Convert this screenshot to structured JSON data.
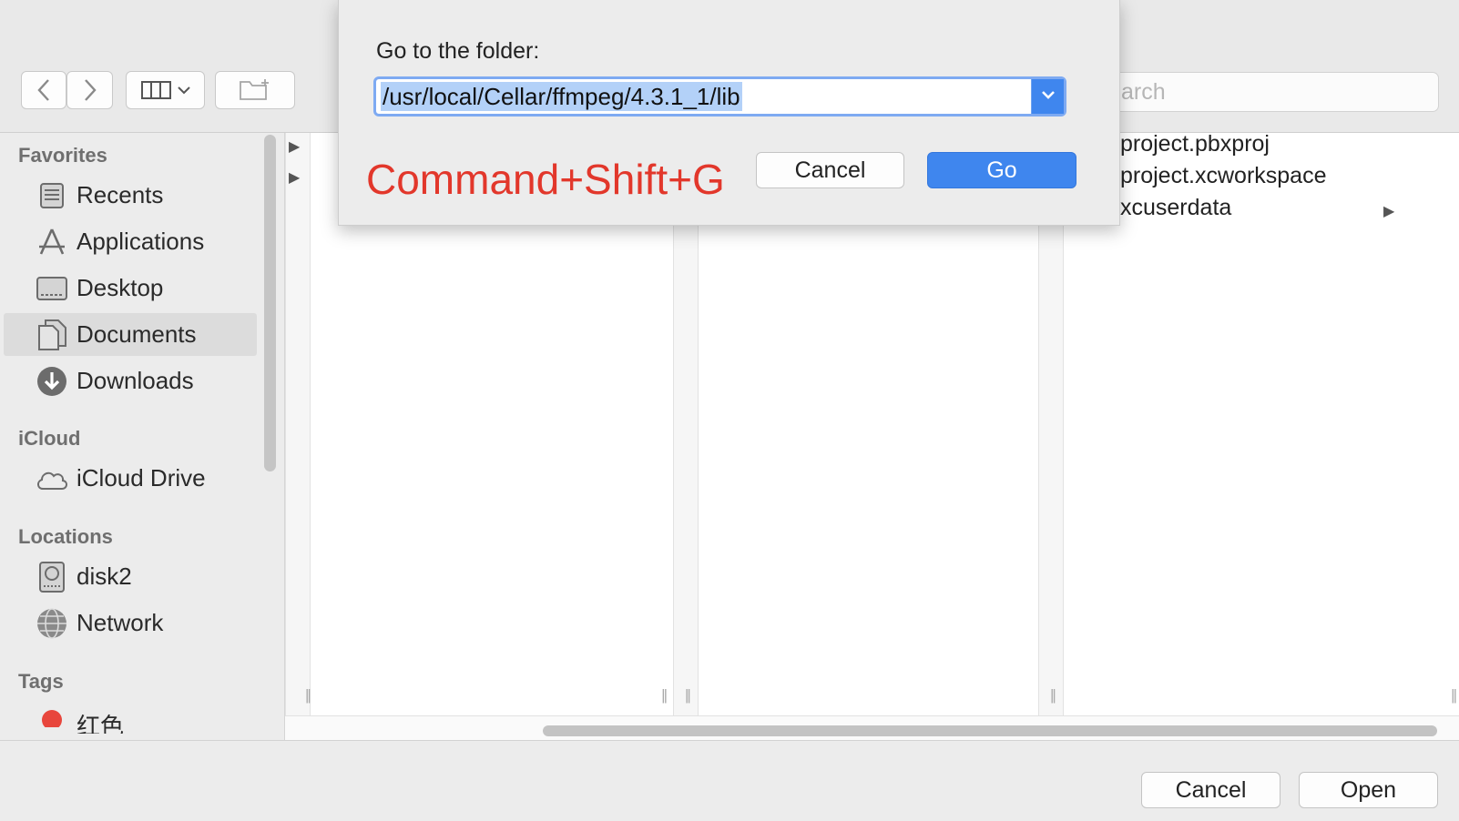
{
  "toolbar": {
    "search_placeholder": "arch",
    "icons": [
      "back-chevron-icon",
      "forward-chevron-icon",
      "column-view-icon",
      "new-folder-icon"
    ]
  },
  "sidebar": {
    "favorites_header": "Favorites",
    "favorites": [
      {
        "label": "Recents",
        "icon": "recents-icon"
      },
      {
        "label": "Applications",
        "icon": "applications-icon"
      },
      {
        "label": "Desktop",
        "icon": "desktop-icon"
      },
      {
        "label": "Documents",
        "icon": "documents-icon",
        "selected": true
      },
      {
        "label": "Downloads",
        "icon": "downloads-icon"
      }
    ],
    "icloud_header": "iCloud",
    "icloud": [
      {
        "label": "iCloud Drive",
        "icon": "cloud-icon"
      }
    ],
    "locations_header": "Locations",
    "locations": [
      {
        "label": "disk2",
        "icon": "disk-icon"
      },
      {
        "label": "Network",
        "icon": "network-icon"
      }
    ],
    "tags_header": "Tags",
    "tags": [
      {
        "label": "红色",
        "color": "#e8463c"
      }
    ]
  },
  "browser": {
    "files": [
      {
        "name": "project.pbxproj"
      },
      {
        "name": "project.xcworkspace"
      },
      {
        "name": "xcuserdata",
        "has_children": true
      }
    ]
  },
  "sheet": {
    "label": "Go to the folder:",
    "path_value": "/usr/local/Cellar/ffmpeg/4.3.1_1/lib",
    "cancel_label": "Cancel",
    "go_label": "Go",
    "shortcut_annotation": "Command+Shift+G",
    "annotation_color": "#e2372b",
    "accent_color": "#3f86ee"
  },
  "bottombar": {
    "cancel_label": "Cancel",
    "open_label": "Open"
  }
}
